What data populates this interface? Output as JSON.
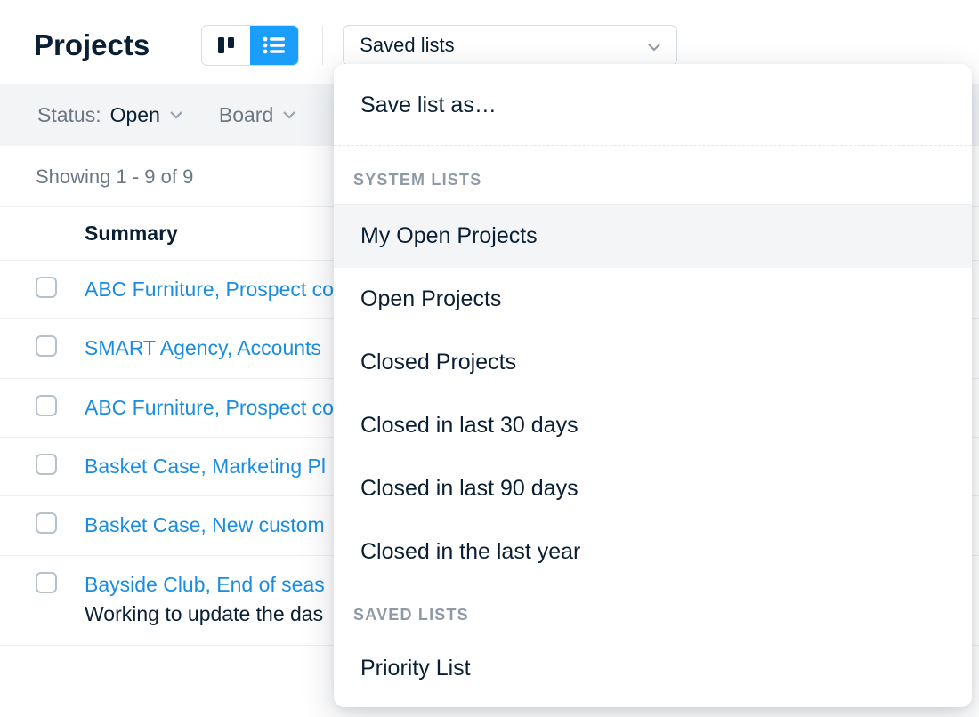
{
  "header": {
    "title": "Projects",
    "saved_lists_label": "Saved lists"
  },
  "filters": {
    "status_label": "Status:",
    "status_value": "Open",
    "board_label": "Board"
  },
  "showing_text": "Showing 1 - 9 of 9",
  "columns": {
    "summary": "Summary"
  },
  "rows": [
    {
      "summary": "ABC Furniture, Prospect co",
      "sub": ""
    },
    {
      "summary": "SMART Agency, Accounts",
      "sub": ""
    },
    {
      "summary": "ABC Furniture, Prospect co",
      "sub": ""
    },
    {
      "summary": "Basket Case, Marketing Pl",
      "sub": ""
    },
    {
      "summary": "Basket Case, New custom",
      "sub": ""
    },
    {
      "summary": "Bayside Club, End of seas",
      "sub": "Working to update the das"
    }
  ],
  "dropdown": {
    "save_as": "Save list as…",
    "system_header": "SYSTEM LISTS",
    "items": [
      "My Open Projects",
      "Open Projects",
      "Closed Projects",
      "Closed in last 30 days",
      "Closed in last 90 days",
      "Closed in the last year"
    ],
    "selected_index": 0,
    "saved_header": "SAVED LISTS",
    "saved_items": [
      "Priority List"
    ]
  }
}
